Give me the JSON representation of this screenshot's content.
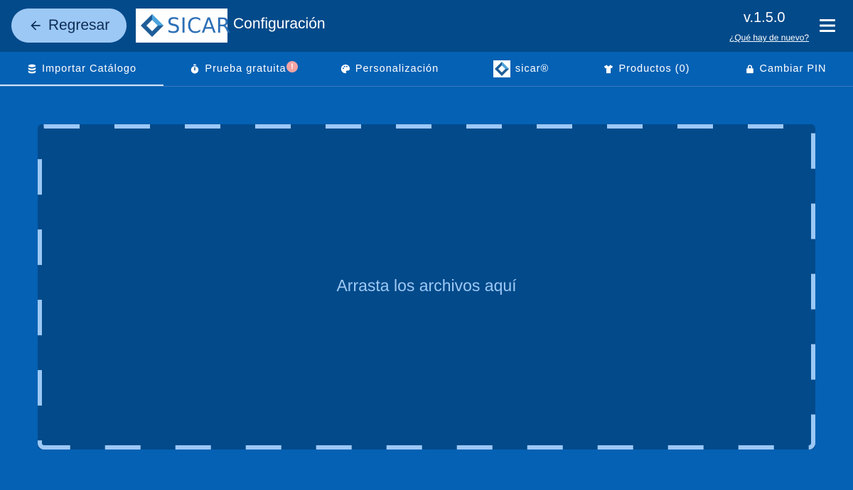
{
  "header": {
    "back_label": "Regresar",
    "logo_text": "SICAR",
    "title": "Configuración",
    "version": "v.1.5.0",
    "whats_new": "¿Qué hay de nuevo?"
  },
  "tabs": [
    {
      "label": "Importar Catálogo",
      "icon": "database-icon",
      "active": true
    },
    {
      "label": "Prueba gratuita",
      "icon": "stopwatch-icon",
      "badge": "!"
    },
    {
      "label": "Personalización",
      "icon": "palette-icon"
    },
    {
      "label": "sicar®",
      "icon": "sicar-logo-icon"
    },
    {
      "label": "Productos (0)",
      "icon": "tshirt-icon"
    },
    {
      "label": "Cambiar PIN",
      "icon": "lock-icon"
    }
  ],
  "dropzone": {
    "text": "Arrasta los archivos aquí"
  },
  "colors": {
    "background": "#0561b4",
    "header": "#024a8a",
    "accent": "#9cc8f5",
    "badge": "#f2a3a3"
  }
}
